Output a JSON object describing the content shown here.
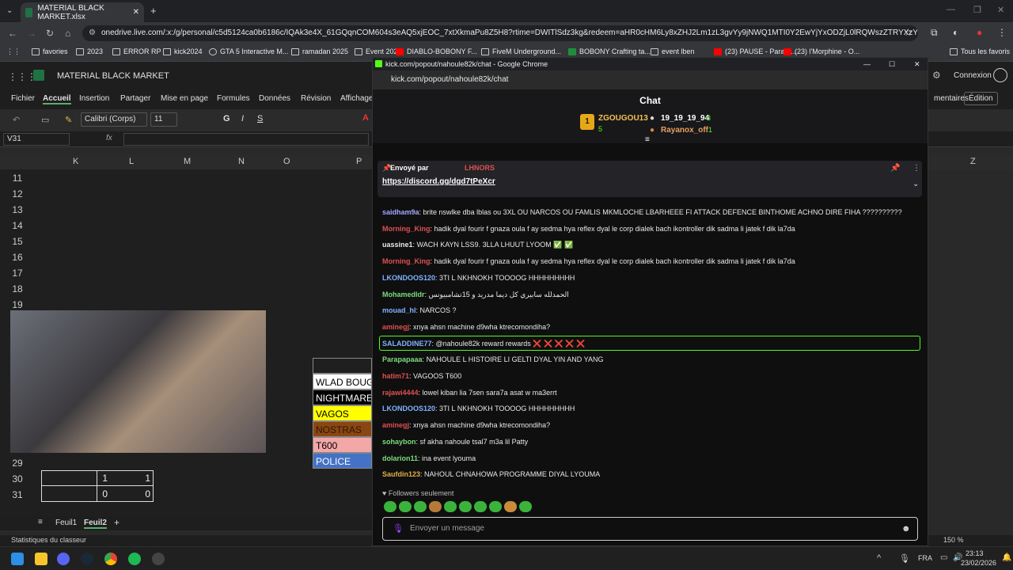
{
  "browser": {
    "tab_title": "MATERIAL BLACK MARKET.xlsx",
    "url": "onedrive.live.com/:x:/g/personal/c5d5124ca0b6186c/IQAk3e4X_61GQqnCOM604s3eAQ5xjEOC_7xtXkmaPu8Z5H8?rtime=DWITlSdz3kg&redeem=aHR0cHM6Ly8xZHJ2Lm1zL3gvYy9jNWQ1MTI0Y2EwYjYxODZjL0lRQWszZTRYXzYxR0dxbkNPTTYwNHMzZUFRNXhqRU9DXzd4dFhrbWFQdThaNUg4",
    "bookmarks": [
      "favories",
      "2023",
      "ERROR RP",
      "kick2024",
      "GTA 5 Interactive M...",
      "ramadan 2025",
      "Event 2026",
      "DIABLO-BOBONY F...",
      "FiveM Underground...",
      "BOBONY Crafting ta...",
      "event lben",
      "(23) PAUSE - Parara...",
      "(23) l'Morphine - O..."
    ],
    "all_bookmarks": "Tous les favoris"
  },
  "excel": {
    "doc_title": "MATERIAL BLACK MARKET",
    "connexion": "Connexion",
    "menu": [
      "Fichier",
      "Accueil",
      "Insertion",
      "Partager",
      "Mise en page",
      "Formules",
      "Données",
      "Révision",
      "Affichage"
    ],
    "comments": "mentaires",
    "edition": "Édition",
    "font_name": "Calibri (Corps)",
    "font_size": "11",
    "cell_ref": "V31",
    "fx": "fx",
    "columns": [
      "K",
      "L",
      "M",
      "N",
      "O",
      "P"
    ],
    "col_z": "Z",
    "rows": [
      "11",
      "12",
      "13",
      "14",
      "15",
      "16",
      "17",
      "18",
      "19",
      "29",
      "30",
      "31"
    ],
    "labels": [
      "WLAD BOUG",
      "NIGHTMARE",
      "VAGOS",
      "NOSTRAS",
      "T600",
      "POLICE"
    ],
    "label_colors": [
      "#ffffff",
      "#000000",
      "#ffff00",
      "#8b4513",
      "#f4a7a7",
      "#4472c4"
    ],
    "row30": [
      "1",
      "1"
    ],
    "row31": [
      "0",
      "0"
    ],
    "sheets": [
      "Feuil1",
      "Feuil2"
    ],
    "add_sheet": "+",
    "status": "Statistiques du classeur",
    "zoom": "150 %"
  },
  "chat": {
    "window_title": "kick.com/popout/nahoule82k/chat - Google Chrome",
    "url": "kick.com/popout/nahoule82k/chat",
    "header": "Chat",
    "leader1": {
      "rank": "1",
      "name": "ZGOUGOU13",
      "count": "5"
    },
    "leader2": {
      "name": "19_19_19_94",
      "count": "3"
    },
    "leader3": {
      "name": "Rayanox_off",
      "count": "1"
    },
    "pinned_by": "Envoyé par",
    "pinned_user": "LHNORS",
    "pinned_link": "https://discord.gg/dgd7tPeXcr",
    "messages": [
      {
        "user": "saidham9a",
        "color": "#a3a8ff",
        "text": "brite nswlke dba lblas ou 3XL OU NARCOS OU FAMLIS MKMLOCHE LBARHEEE FI ATTACK DEFENCE BINTHOME ACHNO DIRE FIHA ??????????"
      },
      {
        "user": "Morning_King",
        "color": "#e05050",
        "text": "hadik dyal fourir f gnaza oula f ay sedma hya reflex dyal le corp dialek bach ikontroller dik sadma li jatek f dik la7da"
      },
      {
        "user": "uassine1",
        "color": "#e8e8e8",
        "text": "WACH KAYN LSS9. 3LLA LHUUT LYOOM ✅ ✅"
      },
      {
        "user": "Morning_King",
        "color": "#e05050",
        "text": "hadik dyal fourir f gnaza oula f ay sedma hya reflex dyal le corp dialek bach ikontroller dik sadma li jatek f dik la7da"
      },
      {
        "user": "LKONDOOS120",
        "color": "#7fb3ff",
        "text": "3TI L NKHNOKH TOOOOG HHHHHHHHH"
      },
      {
        "user": "Mohamedldr",
        "color": "#7cdc7c",
        "text": "الحمدلله سابيري كل ديما مدريد و 15تشامبيونس"
      },
      {
        "user": "mouad_hl",
        "color": "#7fb3ff",
        "text": "NARCOS ?"
      },
      {
        "user": "aminegj",
        "color": "#e05050",
        "text": "xnya ahsn machine d9wha ktrecomondiha?"
      },
      {
        "user": "SALADDINE77",
        "color": "#7fb3ff",
        "text": "@nahoule82k reward rewards ❌ ❌ ❌ ❌ ❌"
      },
      {
        "user": "Parapapaaa",
        "color": "#7cdc7c",
        "text": "NAHOULE L HISTOIRE LI GELTI DYAL YIN AND YANG"
      },
      {
        "user": "hatim71",
        "color": "#e05050",
        "text": "VAGOOS T600"
      },
      {
        "user": "rajawi4444",
        "color": "#e05050",
        "text": "lowel kiban lia 7sen sara7a asat w ma3errt"
      },
      {
        "user": "LKONDOOS120",
        "color": "#7fb3ff",
        "text": "3TI L NKHNOKH TOOOOG HHHHHHHHH"
      },
      {
        "user": "aminegj",
        "color": "#e05050",
        "text": "xnya ahsn machine d9wha ktrecomondiha?"
      },
      {
        "user": "sohaybon",
        "color": "#7cdc7c",
        "text": "sf akha nahoule tsal7 m3a lil Patty"
      },
      {
        "user": "dolarion11",
        "color": "#7cdc7c",
        "text": "ina event lyouma"
      },
      {
        "user": "Saufdin123",
        "color": "#e0b040",
        "text": "NAHOUL CHNAHOWA PROGRAMME DIYAL LYOUMA"
      }
    ],
    "followers_only": "Followers seulement",
    "input_placeholder": "Envoyer un message"
  },
  "taskbar": {
    "lang": "FRA",
    "time": "23:13",
    "date": "23/02/2026"
  }
}
